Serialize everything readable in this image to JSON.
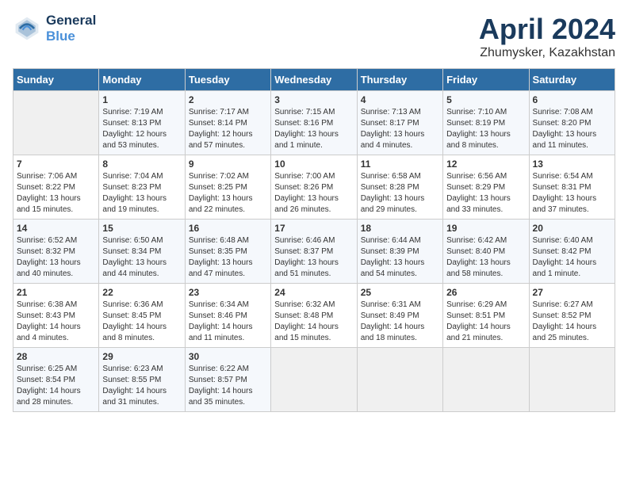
{
  "header": {
    "logo_line1": "General",
    "logo_line2": "Blue",
    "title": "April 2024",
    "subtitle": "Zhumysker, Kazakhstan"
  },
  "weekdays": [
    "Sunday",
    "Monday",
    "Tuesday",
    "Wednesday",
    "Thursday",
    "Friday",
    "Saturday"
  ],
  "weeks": [
    [
      {
        "day": "",
        "sunrise": "",
        "sunset": "",
        "daylight": ""
      },
      {
        "day": "1",
        "sunrise": "Sunrise: 7:19 AM",
        "sunset": "Sunset: 8:13 PM",
        "daylight": "Daylight: 12 hours and 53 minutes."
      },
      {
        "day": "2",
        "sunrise": "Sunrise: 7:17 AM",
        "sunset": "Sunset: 8:14 PM",
        "daylight": "Daylight: 12 hours and 57 minutes."
      },
      {
        "day": "3",
        "sunrise": "Sunrise: 7:15 AM",
        "sunset": "Sunset: 8:16 PM",
        "daylight": "Daylight: 13 hours and 1 minute."
      },
      {
        "day": "4",
        "sunrise": "Sunrise: 7:13 AM",
        "sunset": "Sunset: 8:17 PM",
        "daylight": "Daylight: 13 hours and 4 minutes."
      },
      {
        "day": "5",
        "sunrise": "Sunrise: 7:10 AM",
        "sunset": "Sunset: 8:19 PM",
        "daylight": "Daylight: 13 hours and 8 minutes."
      },
      {
        "day": "6",
        "sunrise": "Sunrise: 7:08 AM",
        "sunset": "Sunset: 8:20 PM",
        "daylight": "Daylight: 13 hours and 11 minutes."
      }
    ],
    [
      {
        "day": "7",
        "sunrise": "Sunrise: 7:06 AM",
        "sunset": "Sunset: 8:22 PM",
        "daylight": "Daylight: 13 hours and 15 minutes."
      },
      {
        "day": "8",
        "sunrise": "Sunrise: 7:04 AM",
        "sunset": "Sunset: 8:23 PM",
        "daylight": "Daylight: 13 hours and 19 minutes."
      },
      {
        "day": "9",
        "sunrise": "Sunrise: 7:02 AM",
        "sunset": "Sunset: 8:25 PM",
        "daylight": "Daylight: 13 hours and 22 minutes."
      },
      {
        "day": "10",
        "sunrise": "Sunrise: 7:00 AM",
        "sunset": "Sunset: 8:26 PM",
        "daylight": "Daylight: 13 hours and 26 minutes."
      },
      {
        "day": "11",
        "sunrise": "Sunrise: 6:58 AM",
        "sunset": "Sunset: 8:28 PM",
        "daylight": "Daylight: 13 hours and 29 minutes."
      },
      {
        "day": "12",
        "sunrise": "Sunrise: 6:56 AM",
        "sunset": "Sunset: 8:29 PM",
        "daylight": "Daylight: 13 hours and 33 minutes."
      },
      {
        "day": "13",
        "sunrise": "Sunrise: 6:54 AM",
        "sunset": "Sunset: 8:31 PM",
        "daylight": "Daylight: 13 hours and 37 minutes."
      }
    ],
    [
      {
        "day": "14",
        "sunrise": "Sunrise: 6:52 AM",
        "sunset": "Sunset: 8:32 PM",
        "daylight": "Daylight: 13 hours and 40 minutes."
      },
      {
        "day": "15",
        "sunrise": "Sunrise: 6:50 AM",
        "sunset": "Sunset: 8:34 PM",
        "daylight": "Daylight: 13 hours and 44 minutes."
      },
      {
        "day": "16",
        "sunrise": "Sunrise: 6:48 AM",
        "sunset": "Sunset: 8:35 PM",
        "daylight": "Daylight: 13 hours and 47 minutes."
      },
      {
        "day": "17",
        "sunrise": "Sunrise: 6:46 AM",
        "sunset": "Sunset: 8:37 PM",
        "daylight": "Daylight: 13 hours and 51 minutes."
      },
      {
        "day": "18",
        "sunrise": "Sunrise: 6:44 AM",
        "sunset": "Sunset: 8:39 PM",
        "daylight": "Daylight: 13 hours and 54 minutes."
      },
      {
        "day": "19",
        "sunrise": "Sunrise: 6:42 AM",
        "sunset": "Sunset: 8:40 PM",
        "daylight": "Daylight: 13 hours and 58 minutes."
      },
      {
        "day": "20",
        "sunrise": "Sunrise: 6:40 AM",
        "sunset": "Sunset: 8:42 PM",
        "daylight": "Daylight: 14 hours and 1 minute."
      }
    ],
    [
      {
        "day": "21",
        "sunrise": "Sunrise: 6:38 AM",
        "sunset": "Sunset: 8:43 PM",
        "daylight": "Daylight: 14 hours and 4 minutes."
      },
      {
        "day": "22",
        "sunrise": "Sunrise: 6:36 AM",
        "sunset": "Sunset: 8:45 PM",
        "daylight": "Daylight: 14 hours and 8 minutes."
      },
      {
        "day": "23",
        "sunrise": "Sunrise: 6:34 AM",
        "sunset": "Sunset: 8:46 PM",
        "daylight": "Daylight: 14 hours and 11 minutes."
      },
      {
        "day": "24",
        "sunrise": "Sunrise: 6:32 AM",
        "sunset": "Sunset: 8:48 PM",
        "daylight": "Daylight: 14 hours and 15 minutes."
      },
      {
        "day": "25",
        "sunrise": "Sunrise: 6:31 AM",
        "sunset": "Sunset: 8:49 PM",
        "daylight": "Daylight: 14 hours and 18 minutes."
      },
      {
        "day": "26",
        "sunrise": "Sunrise: 6:29 AM",
        "sunset": "Sunset: 8:51 PM",
        "daylight": "Daylight: 14 hours and 21 minutes."
      },
      {
        "day": "27",
        "sunrise": "Sunrise: 6:27 AM",
        "sunset": "Sunset: 8:52 PM",
        "daylight": "Daylight: 14 hours and 25 minutes."
      }
    ],
    [
      {
        "day": "28",
        "sunrise": "Sunrise: 6:25 AM",
        "sunset": "Sunset: 8:54 PM",
        "daylight": "Daylight: 14 hours and 28 minutes."
      },
      {
        "day": "29",
        "sunrise": "Sunrise: 6:23 AM",
        "sunset": "Sunset: 8:55 PM",
        "daylight": "Daylight: 14 hours and 31 minutes."
      },
      {
        "day": "30",
        "sunrise": "Sunrise: 6:22 AM",
        "sunset": "Sunset: 8:57 PM",
        "daylight": "Daylight: 14 hours and 35 minutes."
      },
      {
        "day": "",
        "sunrise": "",
        "sunset": "",
        "daylight": ""
      },
      {
        "day": "",
        "sunrise": "",
        "sunset": "",
        "daylight": ""
      },
      {
        "day": "",
        "sunrise": "",
        "sunset": "",
        "daylight": ""
      },
      {
        "day": "",
        "sunrise": "",
        "sunset": "",
        "daylight": ""
      }
    ]
  ]
}
